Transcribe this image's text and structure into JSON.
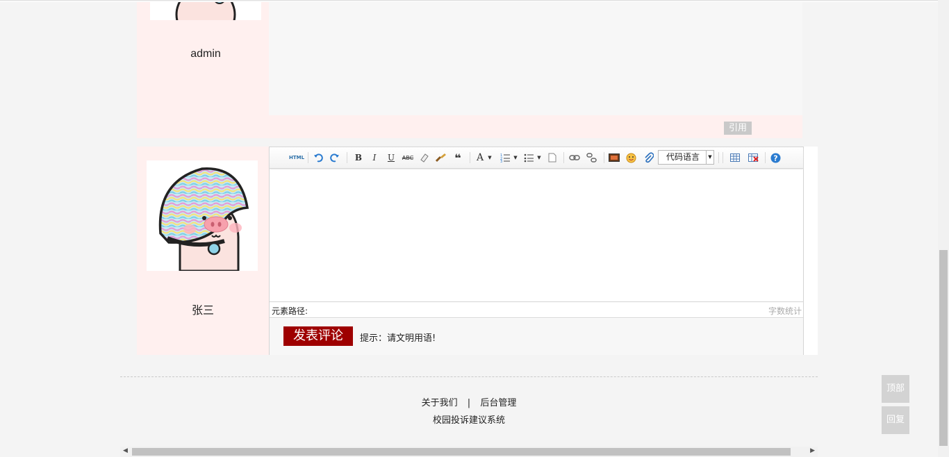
{
  "post1": {
    "username": "admin",
    "quote_label": "引用"
  },
  "reply": {
    "username": "张三",
    "toolbar": {
      "html_label": "HTML",
      "font_color_label": "A",
      "code_language": "代码语言"
    },
    "status": {
      "element_path": "元素路径:",
      "word_count": "字数统计"
    },
    "submit_label": "发表评论",
    "hint": "提示：请文明用语!"
  },
  "footer": {
    "links": [
      "关于我们",
      "后台管理"
    ],
    "separator": "|",
    "site_name": "校园投诉建议系统"
  },
  "float_buttons": {
    "top": "顶部",
    "reply": "回复"
  },
  "colors": {
    "accent": "#9e0000",
    "post_bg": "#fff0ef"
  }
}
